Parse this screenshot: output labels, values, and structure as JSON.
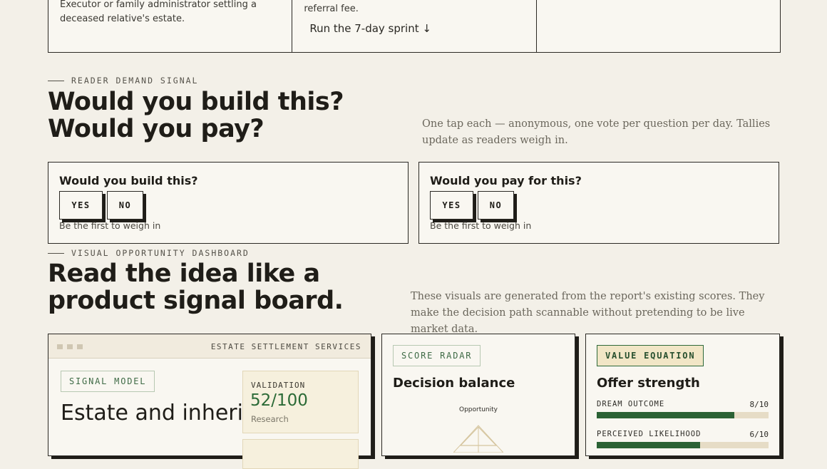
{
  "top_cards": {
    "col1_text": "Executor or family administrator settling a deceased relative's estate.",
    "col2_text": "referral fee.",
    "col2_link": "Run the 7-day sprint ↓"
  },
  "demand": {
    "eyebrow": "READER DEMAND SIGNAL",
    "title": "Would you build this? Would you pay?",
    "lede": "One tap each — anonymous, one vote per question per day. Tallies update as readers weigh in.",
    "build": {
      "question": "Would you build this?",
      "yes": "YES",
      "no": "NO",
      "note": "Be the first to weigh in"
    },
    "pay": {
      "question": "Would you pay for this?",
      "yes": "YES",
      "no": "NO",
      "note": "Be the first to weigh in"
    }
  },
  "dashboard": {
    "eyebrow": "VISUAL OPPORTUNITY DASHBOARD",
    "title": "Read the idea like a product signal board.",
    "lede": "These visuals are generated from the report's existing scores. They make the decision path scannable without pretending to be live market data.",
    "main": {
      "header": "ESTATE SETTLEMENT SERVICES",
      "tag": "SIGNAL MODEL",
      "title": "Estate and inheritance",
      "validation_label": "VALIDATION",
      "validation_value": "52/100",
      "validation_sub": "Research"
    },
    "radar": {
      "tag": "SCORE RADAR",
      "title": "Decision balance",
      "axis_top": "Opportunity"
    },
    "value": {
      "tag": "VALUE EQUATION",
      "title": "Offer strength",
      "metrics": [
        {
          "name": "DREAM OUTCOME",
          "value": "8/10",
          "fraction": 0.8
        },
        {
          "name": "PERCEIVED LIKELIHOOD",
          "value": "6/10",
          "fraction": 0.6
        }
      ]
    }
  },
  "colors": {
    "accent_green": "#2b6235",
    "background": "#f3f0e8",
    "ink": "#1f1d18"
  }
}
